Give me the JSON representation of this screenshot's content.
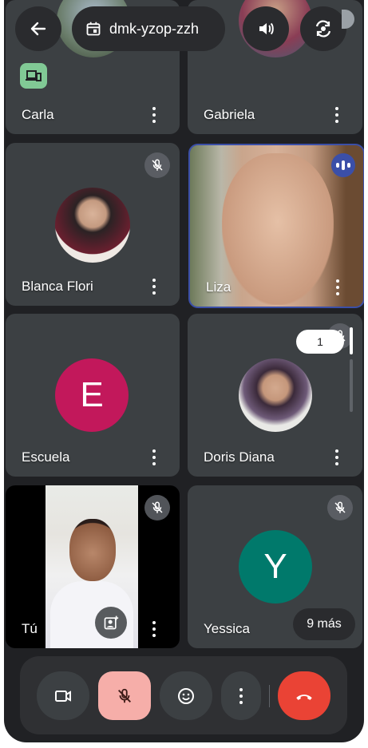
{
  "meeting": {
    "code": "dmk-yzop-zzh"
  },
  "participants": [
    {
      "name": "Carla"
    },
    {
      "name": "Gabriela"
    },
    {
      "name": "Blanca Flori"
    },
    {
      "name": "Liza"
    },
    {
      "name": "Escuela",
      "initial": "E",
      "color": "#c2185b"
    },
    {
      "name": "Doris Diana"
    },
    {
      "name": "Tú"
    },
    {
      "name": "Yessica",
      "initial": "Y",
      "color": "#00796b"
    }
  ],
  "more_button": {
    "label": "9 más"
  },
  "page_indicator": {
    "value": "1"
  },
  "colors": {
    "end_call": "#ea4335",
    "mic_muted": "#f6aea9",
    "speaking": "#3b4fa8",
    "tile": "#3c4043"
  },
  "icons": [
    "back-arrow-icon",
    "calendar-icon",
    "volume-icon",
    "camera-flip-icon",
    "devices-icon",
    "mic-off-icon",
    "audio-wave-icon",
    "camera-icon",
    "emoji-icon",
    "more-vert-icon",
    "end-call-icon",
    "add-person-icon"
  ]
}
